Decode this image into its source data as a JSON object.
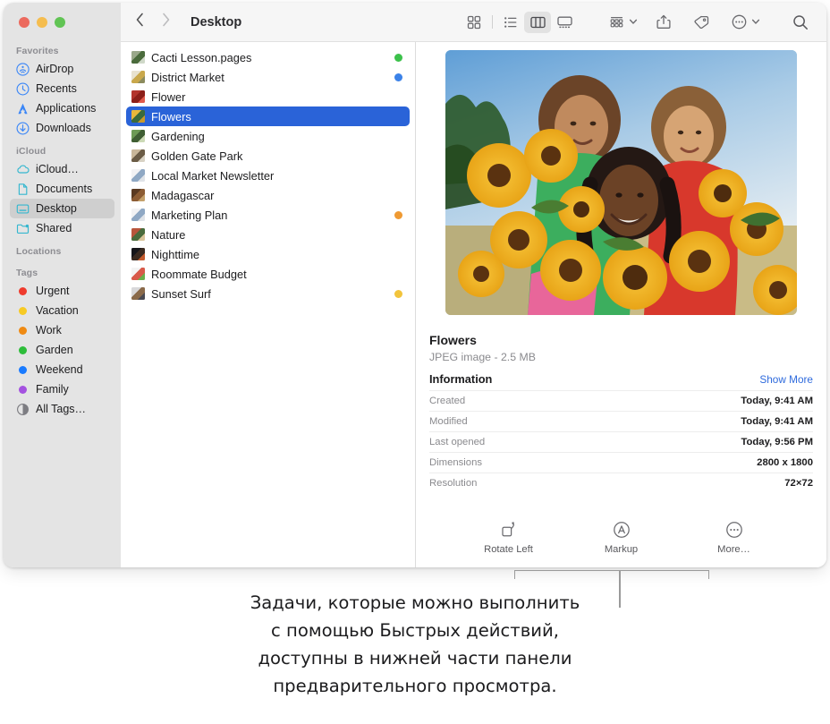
{
  "window": {
    "traffic_lights": [
      {
        "name": "close",
        "color": "#ec6a5e"
      },
      {
        "name": "minimize",
        "color": "#f5bd4f"
      },
      {
        "name": "zoom",
        "color": "#61c454"
      }
    ]
  },
  "toolbar": {
    "back_label": "Back",
    "forward_label": "Forward",
    "breadcrumb": "Desktop",
    "view_buttons": [
      {
        "name": "icon-view",
        "label": "Icon View",
        "active": false
      },
      {
        "name": "list-view",
        "label": "List View",
        "active": false
      },
      {
        "name": "column-view",
        "label": "Column View",
        "active": true
      },
      {
        "name": "gallery-view",
        "label": "Gallery View",
        "active": false
      }
    ],
    "group_label": "Group",
    "share_label": "Share",
    "tags_label": "Tags",
    "more_label": "More",
    "search_label": "Search"
  },
  "sidebar": {
    "sections": [
      {
        "title": "Favorites",
        "items": [
          {
            "label": "AirDrop",
            "icon": "airdrop-icon",
            "selected": false
          },
          {
            "label": "Recents",
            "icon": "clock-icon",
            "selected": false
          },
          {
            "label": "Applications",
            "icon": "applications-icon",
            "selected": false
          },
          {
            "label": "Downloads",
            "icon": "download-icon",
            "selected": false
          }
        ]
      },
      {
        "title": "iCloud",
        "items": [
          {
            "label": "iCloud…",
            "icon": "cloud-icon",
            "selected": false
          },
          {
            "label": "Documents",
            "icon": "document-icon",
            "selected": false
          },
          {
            "label": "Desktop",
            "icon": "desktop-icon",
            "selected": true
          },
          {
            "label": "Shared",
            "icon": "shared-folder-icon",
            "selected": false
          }
        ]
      },
      {
        "title": "Locations",
        "items": []
      },
      {
        "title": "Tags",
        "items": [
          {
            "label": "Urgent",
            "icon": "tag-dot",
            "color": "#ef3b2d",
            "selected": false
          },
          {
            "label": "Vacation",
            "icon": "tag-dot",
            "color": "#f7ca24",
            "selected": false
          },
          {
            "label": "Work",
            "icon": "tag-dot",
            "color": "#ef8a13",
            "selected": false
          },
          {
            "label": "Garden",
            "icon": "tag-dot",
            "color": "#2dbd3a",
            "selected": false
          },
          {
            "label": "Weekend",
            "icon": "tag-dot",
            "color": "#1a7bff",
            "selected": false
          },
          {
            "label": "Family",
            "icon": "tag-dot",
            "color": "#a452e0",
            "selected": false
          },
          {
            "label": "All Tags…",
            "icon": "all-tags-icon",
            "selected": false
          }
        ]
      }
    ]
  },
  "files": [
    {
      "name": "Cacti Lesson.pages",
      "tag_color": "#3cc14b",
      "selected": false,
      "thumb": [
        "#9aa88a",
        "#4a6b3c",
        "#cfd8c8"
      ]
    },
    {
      "name": "District Market",
      "tag_color": "#3b82e8",
      "selected": false,
      "thumb": [
        "#e8e2cf",
        "#c9a84c",
        "#8b8b5e"
      ]
    },
    {
      "name": "Flower",
      "tag_color": "",
      "selected": false,
      "thumb": [
        "#b3342c",
        "#8c1f19",
        "#e05a4c"
      ]
    },
    {
      "name": "Flowers",
      "tag_color": "",
      "selected": true,
      "thumb": [
        "#e8b83c",
        "#3b6b3c",
        "#c99a2c"
      ]
    },
    {
      "name": "Gardening",
      "tag_color": "",
      "selected": false,
      "thumb": [
        "#6d9a55",
        "#3f5e33",
        "#cbd9b5"
      ]
    },
    {
      "name": "Golden Gate Park",
      "tag_color": "",
      "selected": false,
      "thumb": [
        "#c9b79a",
        "#6b5c46",
        "#d8d2c4"
      ]
    },
    {
      "name": "Local Market Newsletter",
      "tag_color": "",
      "selected": false,
      "thumb": [
        "#f2f2f4",
        "#8fa8c4",
        "#dfe3e8"
      ]
    },
    {
      "name": "Madagascar",
      "tag_color": "",
      "selected": false,
      "thumb": [
        "#5a3a22",
        "#8c5c34",
        "#c4a06a"
      ]
    },
    {
      "name": "Marketing Plan",
      "tag_color": "#ef9a33",
      "selected": false,
      "thumb": [
        "#f2f2f4",
        "#8fa8c4",
        "#dfe3e8"
      ]
    },
    {
      "name": "Nature",
      "tag_color": "",
      "selected": false,
      "thumb": [
        "#b8553c",
        "#4a6b3c",
        "#d8c49a"
      ]
    },
    {
      "name": "Nighttime",
      "tag_color": "",
      "selected": false,
      "thumb": [
        "#16161a",
        "#3a2a20",
        "#c45a2c"
      ]
    },
    {
      "name": "Roommate Budget",
      "tag_color": "",
      "selected": false,
      "thumb": [
        "#f4f4f4",
        "#d85a4a",
        "#6ab04c"
      ]
    },
    {
      "name": "Sunset Surf",
      "tag_color": "#f2c43c",
      "selected": false,
      "thumb": [
        "#d8d8da",
        "#8a6a4a",
        "#4a4a52"
      ]
    }
  ],
  "preview": {
    "title": "Flowers",
    "subtitle": "JPEG image - 2.5 MB",
    "information_label": "Information",
    "show_more_label": "Show More",
    "show_more_color": "#2f6bdd",
    "rows": [
      {
        "label": "Created",
        "value": "Today, 9:41 AM"
      },
      {
        "label": "Modified",
        "value": "Today, 9:41 AM"
      },
      {
        "label": "Last opened",
        "value": "Today, 9:56 PM"
      },
      {
        "label": "Dimensions",
        "value": "2800 x 1800"
      },
      {
        "label": "Resolution",
        "value": "72×72"
      }
    ],
    "quick_actions": [
      {
        "label": "Rotate Left",
        "icon": "rotate-left-icon"
      },
      {
        "label": "Markup",
        "icon": "markup-icon"
      },
      {
        "label": "More…",
        "icon": "more-circle-icon"
      }
    ]
  },
  "caption": {
    "lines": [
      "Задачи, которые можно выполнить",
      "с помощью Быстрых действий,",
      "доступны в нижней части панели",
      "предварительного просмотра."
    ]
  }
}
